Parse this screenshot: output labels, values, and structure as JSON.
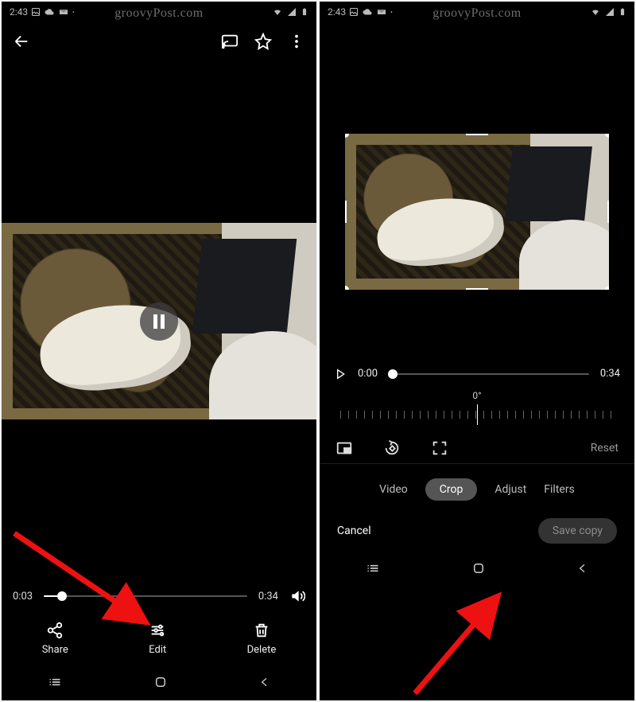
{
  "status": {
    "time": "2:43",
    "watermark": "groovyPost.com"
  },
  "left": {
    "seek": {
      "current": "0:03",
      "total": "0:34",
      "progress_pct": 9
    },
    "actions": {
      "share": "Share",
      "edit": "Edit",
      "delete": "Delete"
    }
  },
  "right": {
    "timeline": {
      "current": "0:00",
      "total": "0:34",
      "progress_pct": 2
    },
    "rotation_degrees": "0°",
    "reset_label": "Reset",
    "tabs": {
      "video": "Video",
      "crop": "Crop",
      "adjust": "Adjust",
      "filters": "Filters"
    },
    "cancel_label": "Cancel",
    "save_label": "Save copy"
  }
}
